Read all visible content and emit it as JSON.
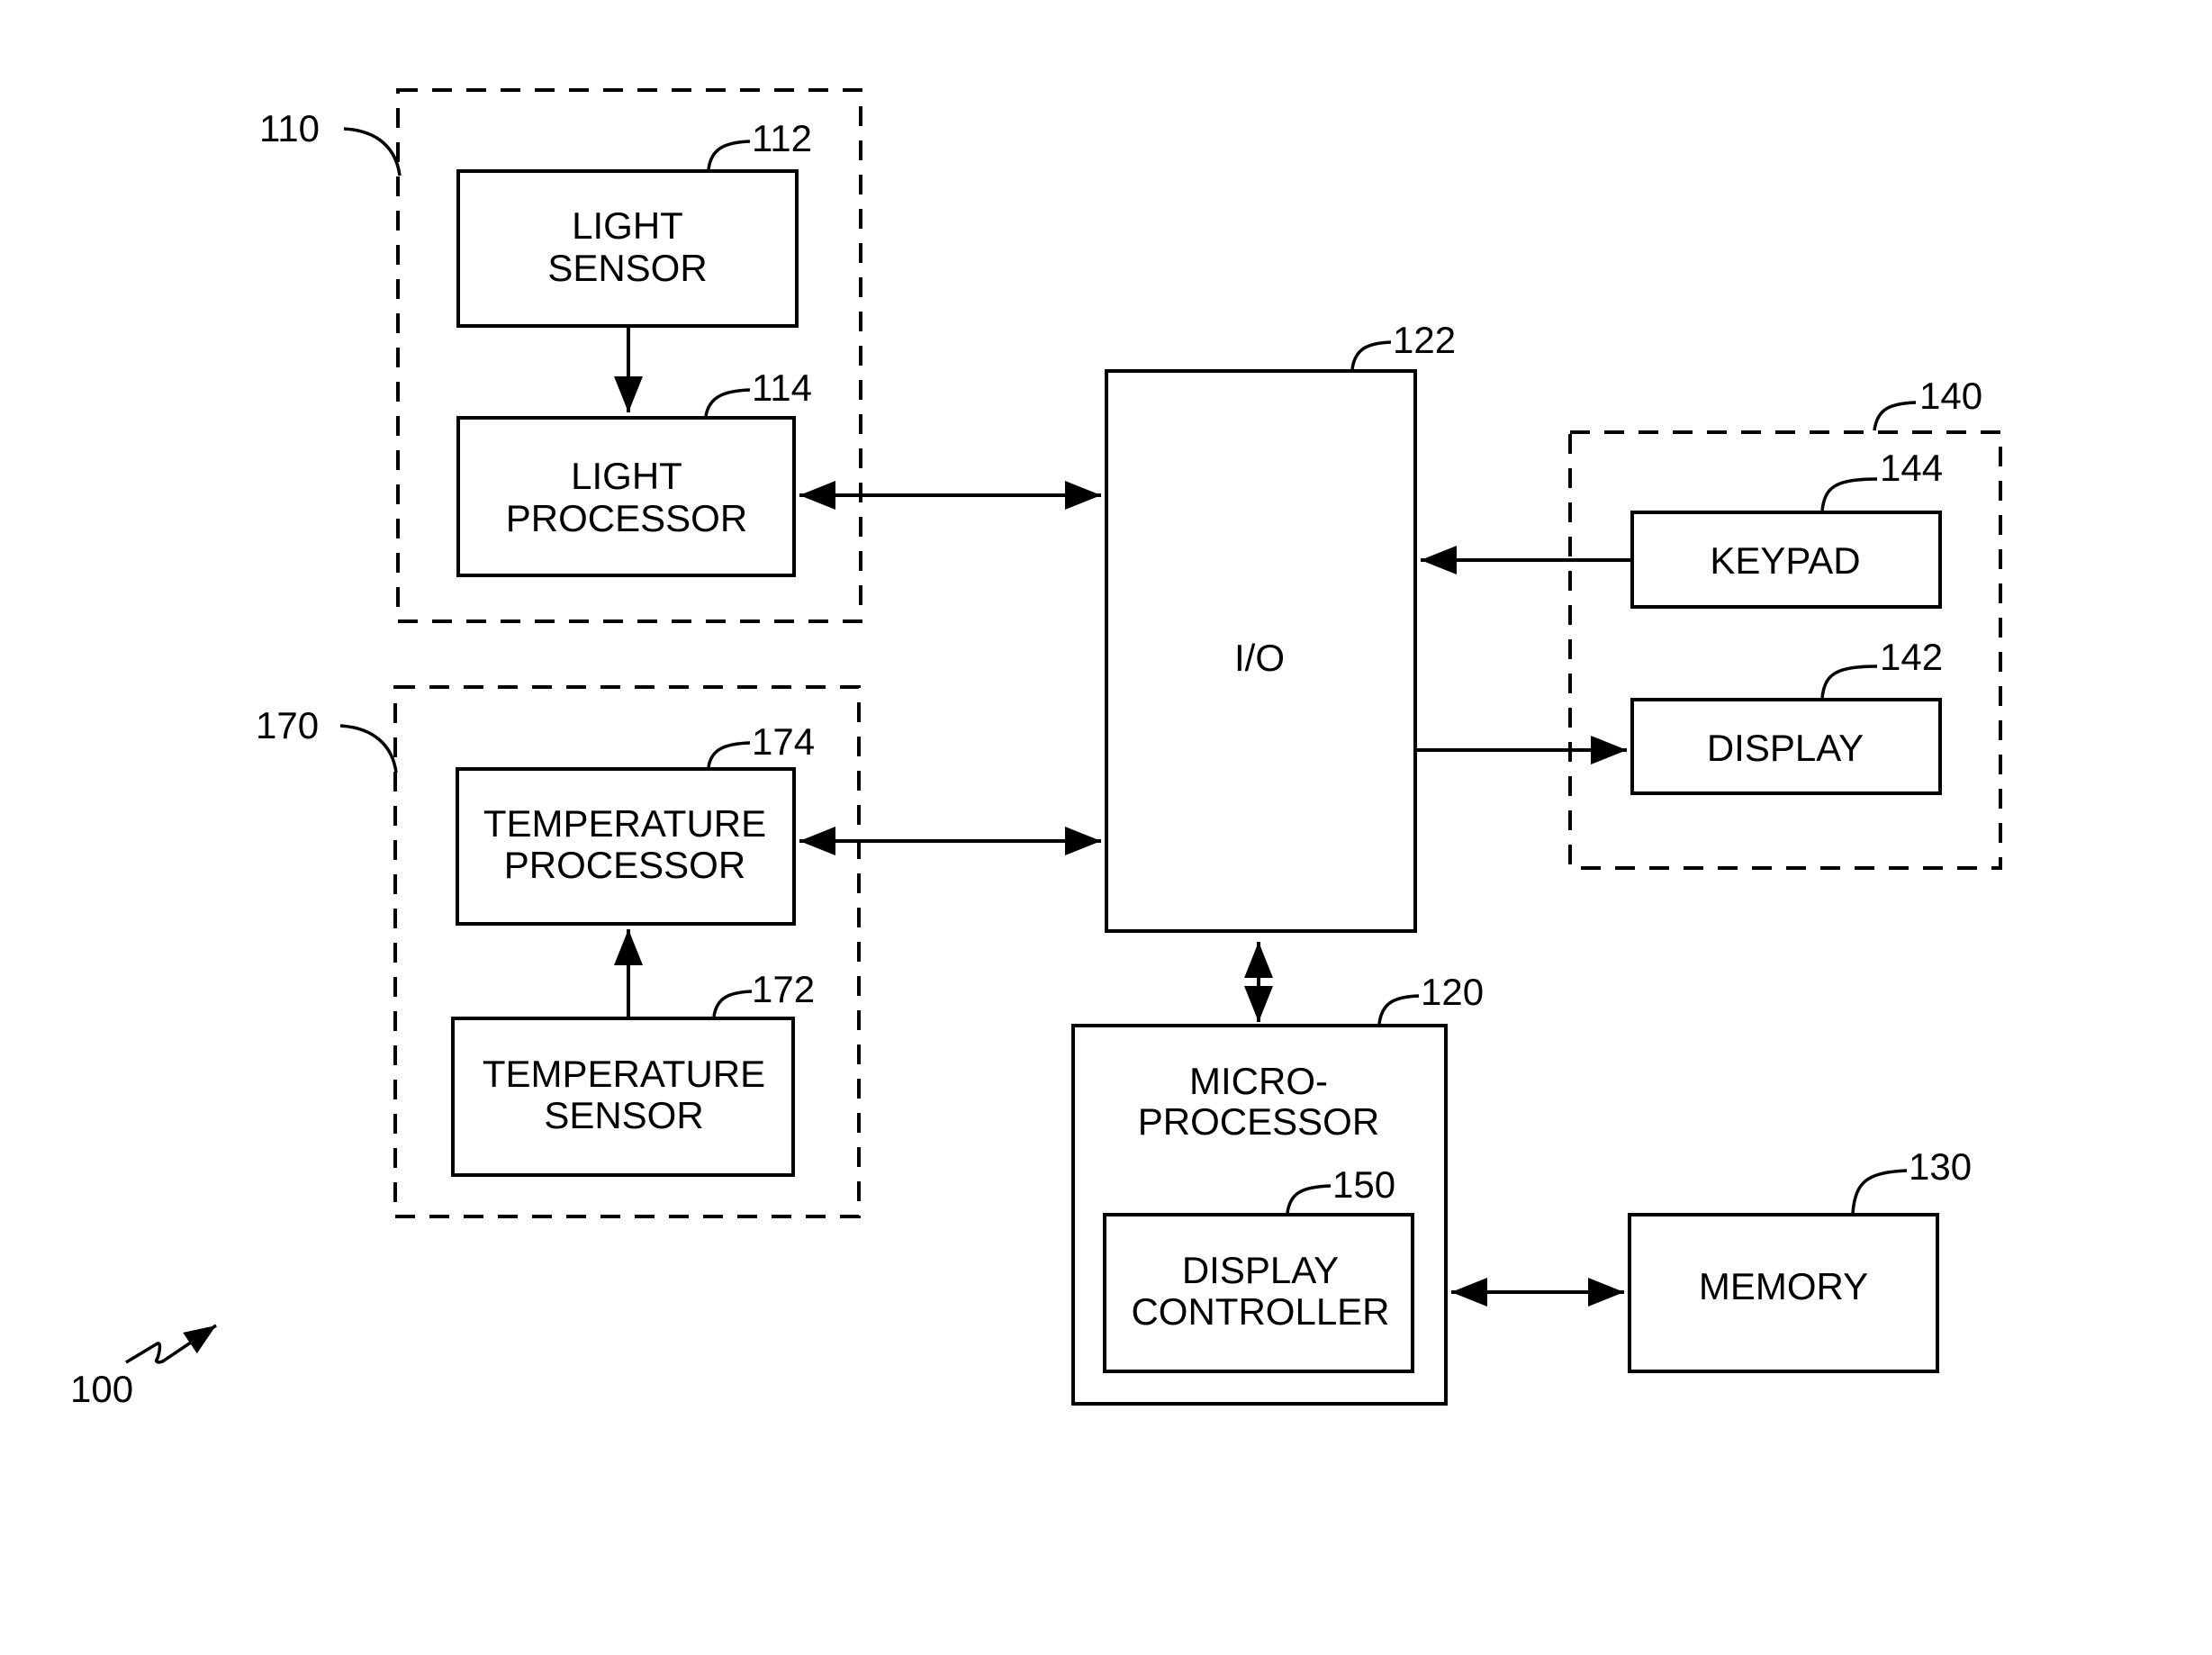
{
  "figure": {
    "reference": "100",
    "groups": [
      {
        "id": "light_group",
        "ref": "110"
      },
      {
        "id": "temperature_group",
        "ref": "170"
      },
      {
        "id": "user_interface_group",
        "ref": "140"
      }
    ],
    "blocks": {
      "light_sensor": {
        "ref": "112",
        "lines": [
          "LIGHT",
          "SENSOR"
        ]
      },
      "light_processor": {
        "ref": "114",
        "lines": [
          "LIGHT",
          "PROCESSOR"
        ]
      },
      "temperature_processor": {
        "ref": "174",
        "lines": [
          "TEMPERATURE",
          "PROCESSOR"
        ]
      },
      "temperature_sensor": {
        "ref": "172",
        "lines": [
          "TEMPERATURE",
          "SENSOR"
        ]
      },
      "io": {
        "ref": "122",
        "lines": [
          "I/O"
        ]
      },
      "keypad": {
        "ref": "144",
        "lines": [
          "KEYPAD"
        ]
      },
      "display": {
        "ref": "142",
        "lines": [
          "DISPLAY"
        ]
      },
      "microprocessor": {
        "ref": "120",
        "lines": [
          "MICRO-",
          "PROCESSOR"
        ]
      },
      "display_controller": {
        "ref": "150",
        "lines": [
          "DISPLAY",
          "CONTROLLER"
        ]
      },
      "memory": {
        "ref": "130",
        "lines": [
          "MEMORY"
        ]
      }
    },
    "connections": [
      {
        "from": "light_sensor",
        "to": "light_processor",
        "direction": "one-way"
      },
      {
        "from": "light_processor",
        "to": "io",
        "direction": "two-way"
      },
      {
        "from": "temperature_sensor",
        "to": "temperature_processor",
        "direction": "one-way"
      },
      {
        "from": "temperature_processor",
        "to": "io",
        "direction": "two-way"
      },
      {
        "from": "keypad",
        "to": "io",
        "direction": "one-way"
      },
      {
        "from": "io",
        "to": "display",
        "direction": "one-way"
      },
      {
        "from": "io",
        "to": "microprocessor",
        "direction": "two-way"
      },
      {
        "from": "display_controller",
        "to": "memory",
        "direction": "two-way"
      }
    ]
  }
}
